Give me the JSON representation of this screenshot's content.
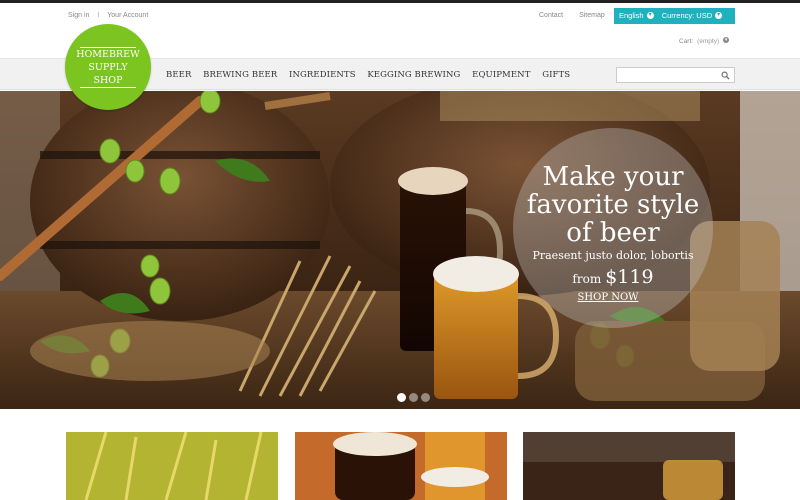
{
  "top_links": {
    "sign_in": "Sign in",
    "separator": "I",
    "your_account": "Your Account",
    "contact": "Contact",
    "sitemap": "Sitemap"
  },
  "lang_currency": {
    "language": "English",
    "currency": "Currency: USD"
  },
  "cart": {
    "label": "Cart:",
    "status": "(empty)"
  },
  "logo": {
    "line1": "HOMEBREW",
    "line2": "SUPPLY",
    "line3": "SHOP"
  },
  "nav": {
    "items": [
      "BEER",
      "BREWING BEER",
      "INGREDIENTS",
      "KEGGING BREWING",
      "EQUIPMENT",
      "GIFTS"
    ]
  },
  "search": {
    "placeholder": ""
  },
  "hero": {
    "title_line1": "Make your",
    "title_line2": "favorite style",
    "title_line3": "of beer",
    "subtitle": "Praesent justo dolor, lobortis",
    "price_from": "from",
    "price_amount": "$119",
    "cta": "SHOP NOW",
    "slides": 3,
    "active_slide": 1
  },
  "colors": {
    "accent": "#1fb2be",
    "logo_green": "#7cc41f"
  }
}
